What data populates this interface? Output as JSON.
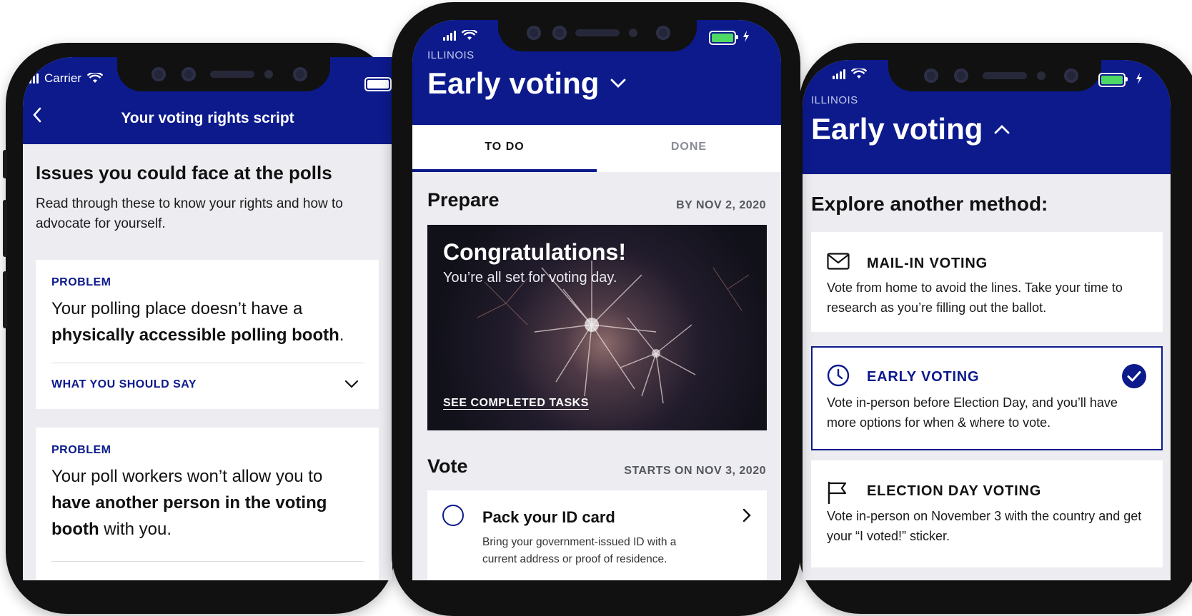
{
  "left_phone": {
    "status": {
      "carrier": "Carrier"
    },
    "header": {
      "back_icon": "chevron-left-icon",
      "title": "Your voting rights script"
    },
    "intro": {
      "heading": "Issues you could face at the polls",
      "body": "Read through these to know your rights and how to advocate for yourself."
    },
    "problems": [
      {
        "label": "PROBLEM",
        "text_pre": "Your polling place doesn’t have a ",
        "text_bold": "physically accessible polling booth",
        "text_post": ".",
        "toggle": "WHAT YOU SHOULD SAY"
      },
      {
        "label": "PROBLEM",
        "text_pre": "Your poll workers won’t allow you to ",
        "text_bold": "have another person in the voting booth",
        "text_post": " with you."
      }
    ]
  },
  "middle_phone": {
    "state": "ILLINOIS",
    "title": "Early voting",
    "tabs": [
      {
        "label": "TO DO",
        "active": true
      },
      {
        "label": "DONE",
        "active": false
      }
    ],
    "prepare": {
      "heading": "Prepare",
      "date": "BY NOV 2, 2020",
      "banner_title": "Congratulations!",
      "banner_subtitle": "You’re all set for voting day.",
      "banner_link": "SEE COMPLETED TASKS"
    },
    "vote": {
      "heading": "Vote",
      "date": "STARTS ON NOV 3, 2020",
      "task_title": "Pack your ID card",
      "task_body": "Bring your government-issued ID with a current address or proof of residence."
    }
  },
  "right_phone": {
    "state": "ILLINOIS",
    "title": "Early voting",
    "explore_heading": "Explore another method:",
    "methods": [
      {
        "icon": "envelope-icon",
        "title": "MAIL-IN VOTING",
        "body": "Vote from home to avoid the lines. Take your time to research as you’re filling out the ballot.",
        "selected": false
      },
      {
        "icon": "clock-icon",
        "title": "EARLY VOTING",
        "body": "Vote in-person before Election Day, and you’ll have more options for when & where to vote.",
        "selected": true
      },
      {
        "icon": "flag-icon",
        "title": "ELECTION DAY VOTING",
        "body": "Vote in-person on November 3 with the country and get your “I voted!” sticker.",
        "selected": false
      }
    ]
  },
  "colors": {
    "navy": "#0c1a8c",
    "background": "#ececf1",
    "battery_green": "#4cd964"
  }
}
